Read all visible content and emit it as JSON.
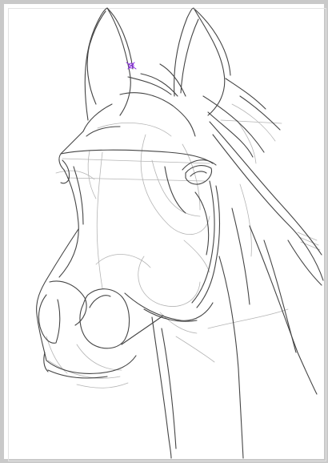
{
  "artwork": {
    "subject_icon": "horse-head-sketch-icon",
    "stroke_color": "#4a4a4a",
    "light_stroke_color": "#9a9a9a",
    "frame_color": "#c9c9c9",
    "cursor_color": "#8a2be2"
  }
}
